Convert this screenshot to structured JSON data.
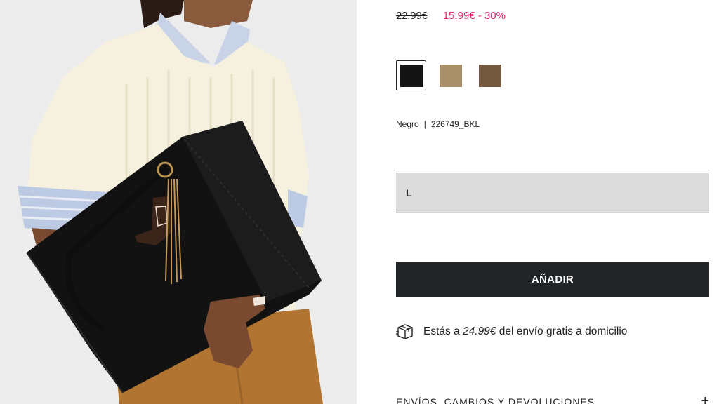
{
  "product": {
    "image_alt": "Woman holding a black tote bag with a cowboy boot keychain",
    "price": {
      "original": "22.99€",
      "sale": "15.99€ - 30%"
    },
    "colors": [
      {
        "name": "black",
        "hex": "#141414",
        "selected": true
      },
      {
        "name": "camel",
        "hex": "#a88f69",
        "selected": false
      },
      {
        "name": "brown",
        "hex": "#74583f",
        "selected": false
      }
    ],
    "selected_color_label": "Negro",
    "separator": "|",
    "reference": "226749_BKL",
    "size": {
      "selected": "L"
    },
    "add_button_label": "AÑADIR",
    "shipping": {
      "prefix": "Estás a",
      "amount": "24.99€",
      "suffix": "del envío gratis a domicilio"
    },
    "accordion": {
      "title": "ENVÍOS, CAMBIOS Y DEVOLUCIONES",
      "toggle": "+"
    }
  },
  "theme": {
    "accent_sale": "#e0266c",
    "button_bg": "#222528",
    "select_bg": "#dcdcdc"
  }
}
